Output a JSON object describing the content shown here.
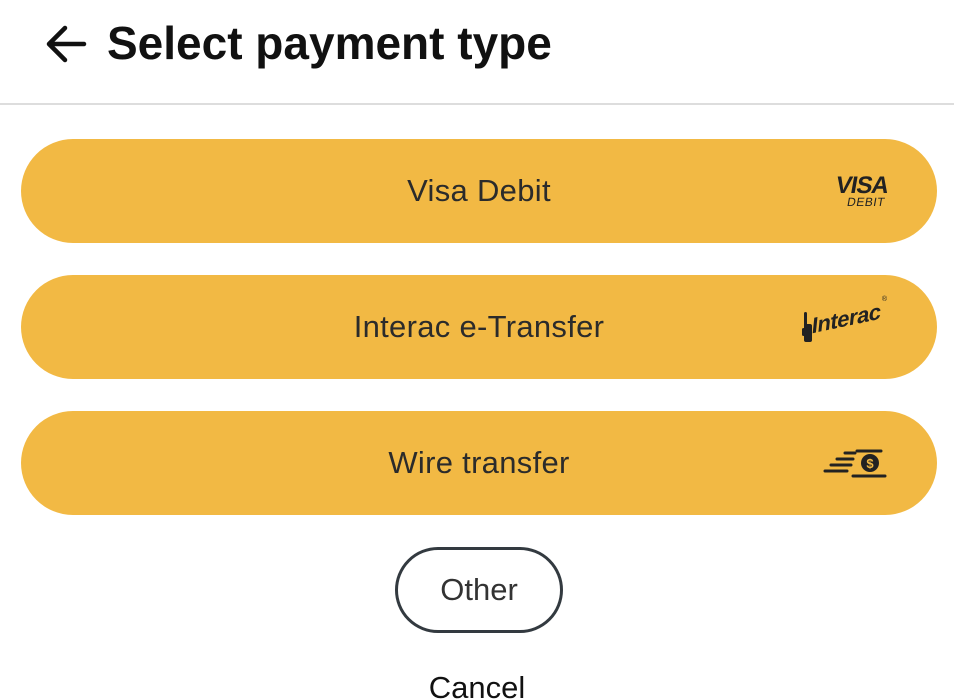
{
  "header": {
    "title": "Select payment type",
    "back_icon": "arrow-left-icon"
  },
  "options": [
    {
      "label": "Visa Debit",
      "icon": "visa-debit-logo",
      "logo_main": "VISA",
      "logo_sub": "DEBIT"
    },
    {
      "label": "Interac e-Transfer",
      "icon": "interac-logo",
      "logo_word": "Interac",
      "logo_mark": "®"
    },
    {
      "label": "Wire transfer",
      "icon": "money-transfer-icon"
    }
  ],
  "other_button": {
    "label": "Other"
  },
  "cancel": {
    "label": "Cancel"
  },
  "colors": {
    "option_background": "#f2b944",
    "text": "#111111",
    "outline": "#333a40",
    "divider": "#dddddd"
  }
}
